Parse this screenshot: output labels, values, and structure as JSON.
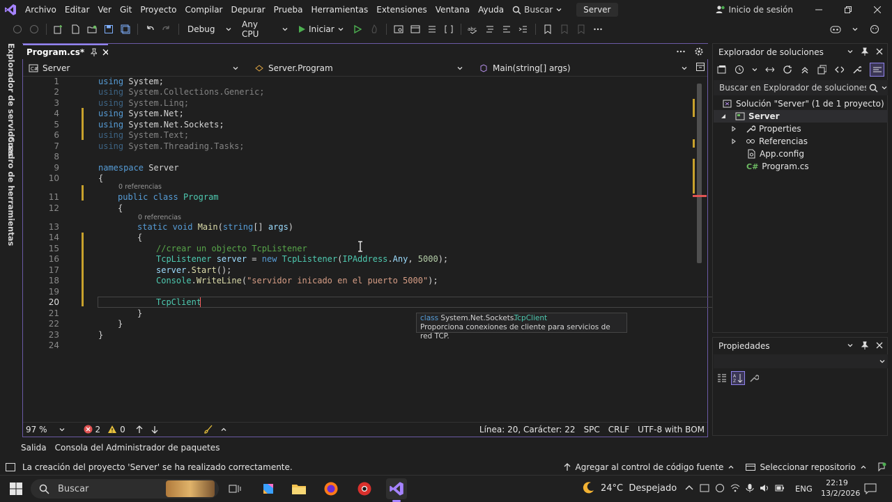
{
  "menu": {
    "items": [
      "Archivo",
      "Editar",
      "Ver",
      "Git",
      "Proyecto",
      "Compilar",
      "Depurar",
      "Prueba",
      "Herramientas",
      "Extensiones",
      "Ventana",
      "Ayuda"
    ],
    "search_label": "Buscar",
    "solution_name": "Server",
    "signin_label": "Inicio de sesión"
  },
  "toolbar": {
    "config": "Debug",
    "platform": "Any CPU",
    "start_label": "Iniciar"
  },
  "left_tabs": {
    "server_explorer": "Explorador de servidores",
    "toolbox": "Cuadro de herramientas"
  },
  "editor": {
    "tab_label": "Program.cs*",
    "nav": {
      "project": "Server",
      "class": "Server.Program",
      "member": "Main(string[] args)"
    },
    "references_label": "0 referencias",
    "tooltip": {
      "kind": "class",
      "namespace": "System.Net.Sockets.",
      "type": "TcpClient",
      "description": "Proporciona conexiones de cliente para servicios de red TCP."
    },
    "line_numbers": [
      "1",
      "2",
      "3",
      "4",
      "5",
      "6",
      "7",
      "8",
      "9",
      "10",
      "11",
      "12",
      "13",
      "14",
      "15",
      "16",
      "17",
      "18",
      "19",
      "20",
      "21",
      "22",
      "23",
      "24"
    ],
    "code": {
      "l1": [
        "using",
        " System;"
      ],
      "l2": [
        "using",
        " System.Collections.Generic;"
      ],
      "l3": [
        "using",
        " System.Linq;"
      ],
      "l4": [
        "using",
        " System.Net;"
      ],
      "l5": [
        "using",
        " System.Net.Sockets;"
      ],
      "l6": [
        "using",
        " System.Text;"
      ],
      "l7": [
        "using",
        " System.Threading.Tasks;"
      ],
      "l9": [
        "namespace",
        " Server"
      ],
      "l10": "{",
      "l11": [
        "public",
        " class",
        " Program"
      ],
      "l12": "{",
      "l13": [
        "static",
        " void",
        " Main",
        "(",
        "string",
        "[] ",
        "args",
        ")"
      ],
      "l14": "{",
      "l15": "//crear un objecto TcpListener",
      "l16": [
        "TcpListener",
        " server",
        " = ",
        "new",
        " TcpListener",
        "(",
        "IPAddress",
        ".",
        "Any",
        ", ",
        "5000",
        ");"
      ],
      "l17": [
        "server",
        ".",
        "Start",
        "();"
      ],
      "l18": [
        "Console",
        ".",
        "WriteLine",
        "(",
        "\"servidor inicado en el puerto 5000\"",
        ");"
      ],
      "l20": "TcpClient",
      "l21": "}",
      "l22": "}",
      "l23": "}"
    }
  },
  "status": {
    "zoom": "97 %",
    "errors": "2",
    "warnings": "0",
    "position": "Línea: 20, Carácter: 22",
    "spc": "SPC",
    "eol": "CRLF",
    "encoding": "UTF-8 with BOM"
  },
  "solution_explorer": {
    "title": "Explorador de soluciones",
    "search_placeholder": "Buscar en Explorador de soluciones (Ctr",
    "solution": "Solución \"Server\" (1 de 1 proyecto)",
    "project": "Server",
    "items": [
      "Properties",
      "Referencias",
      "App.config",
      "Program.cs"
    ]
  },
  "properties": {
    "title": "Propiedades"
  },
  "bottom_tabs": [
    "Salida",
    "Consola del Administrador de paquetes"
  ],
  "vs_status": {
    "message": "La creación del proyecto 'Server' se ha realizado correctamente.",
    "source_control": "Agregar al control de código fuente",
    "repository": "Seleccionar repositorio"
  },
  "taskbar": {
    "search": "Buscar",
    "weather": "24°C  Despejado",
    "lang": "ENG",
    "time": "22:19",
    "date": "13/2/2026"
  },
  "colors": {
    "accent": "#9184ee",
    "keyword": "#569cd6",
    "type": "#4ec9b0",
    "comment": "#57a64a",
    "string": "#d69d85"
  }
}
